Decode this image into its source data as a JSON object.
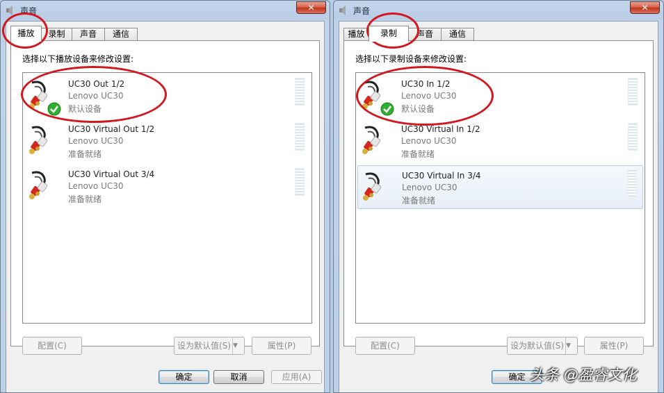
{
  "windows": [
    {
      "title": "声音",
      "close_label": "✕",
      "tabs": [
        {
          "label": "播放",
          "active": true
        },
        {
          "label": "录制",
          "active": false
        },
        {
          "label": "声音",
          "active": false
        },
        {
          "label": "通信",
          "active": false
        }
      ],
      "instruction": "选择以下播放设备来修改设置:",
      "devices": [
        {
          "name": "UC30 Out 1/2",
          "sub": "Lenovo UC30",
          "status": "默认设备",
          "default": true
        },
        {
          "name": "UC30 Virtual Out 1/2",
          "sub": "Lenovo UC30",
          "status": "准备就绪",
          "default": false
        },
        {
          "name": "UC30 Virtual Out 3/4",
          "sub": "Lenovo UC30",
          "status": "准备就绪",
          "default": false
        }
      ],
      "buttons": {
        "configure": "配置(C)",
        "set_default": "设为默认值(S)",
        "properties": "属性(P)",
        "ok": "确定",
        "cancel": "取消",
        "apply": "应用(A)"
      }
    },
    {
      "title": "声音",
      "close_label": "✕",
      "tabs": [
        {
          "label": "播放",
          "active": false
        },
        {
          "label": "录制",
          "active": true
        },
        {
          "label": "声音",
          "active": false
        },
        {
          "label": "通信",
          "active": false
        }
      ],
      "instruction": "选择以下录制设备来修改设置:",
      "devices": [
        {
          "name": "UC30 In 1/2",
          "sub": "Lenovo UC30",
          "status": "默认设备",
          "default": true
        },
        {
          "name": "UC30 Virtual In 1/2",
          "sub": "Lenovo UC30",
          "status": "准备就绪",
          "default": false
        },
        {
          "name": "UC30 Virtual In 3/4",
          "sub": "Lenovo UC30",
          "status": "准备就绪",
          "default": false,
          "selected": true
        }
      ],
      "buttons": {
        "configure": "配置(C)",
        "set_default": "设为默认值(S)",
        "properties": "属性(P)",
        "ok": "确定"
      }
    }
  ],
  "watermark": "头条 @盈睿文化",
  "colors": {
    "annotation_red": "#d0181e",
    "default_check": "#2fae2f"
  }
}
